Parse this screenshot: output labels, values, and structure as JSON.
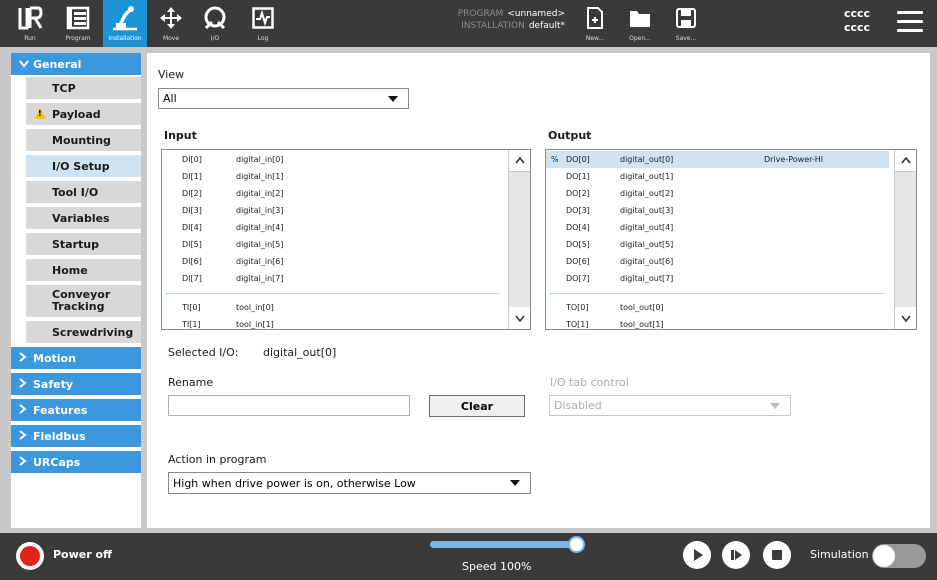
{
  "topbar": {
    "tabs": [
      {
        "label": "Run",
        "icon": "ur-logo-icon"
      },
      {
        "label": "Program",
        "icon": "program-icon"
      },
      {
        "label": "Installation",
        "icon": "installation-icon"
      },
      {
        "label": "Move",
        "icon": "move-icon"
      },
      {
        "label": "I/O",
        "icon": "io-icon"
      },
      {
        "label": "Log",
        "icon": "log-icon"
      }
    ],
    "program_key": "PROGRAM",
    "program_value": "<unnamed>",
    "installation_key": "INSTALLATION",
    "installation_value": "default*",
    "file_buttons": [
      {
        "label": "New...",
        "icon": "new-file-icon"
      },
      {
        "label": "Open...",
        "icon": "folder-icon"
      },
      {
        "label": "Save...",
        "icon": "save-icon"
      }
    ],
    "user_line1": "cccc",
    "user_line2": "cccc",
    "accent_color": "#1b94d6"
  },
  "sidebar": {
    "sections": [
      {
        "label": "General",
        "expanded": true
      },
      {
        "label": "Motion"
      },
      {
        "label": "Safety"
      },
      {
        "label": "Features"
      },
      {
        "label": "Fieldbus"
      },
      {
        "label": "URCaps"
      }
    ],
    "general_items": [
      {
        "label": "TCP"
      },
      {
        "label": "Payload",
        "warning": true
      },
      {
        "label": "Mounting"
      },
      {
        "label": "I/O Setup",
        "selected": true
      },
      {
        "label": "Tool I/O"
      },
      {
        "label": "Variables"
      },
      {
        "label": "Startup"
      },
      {
        "label": "Home"
      },
      {
        "label": "Conveyor Tracking"
      },
      {
        "label": "Screwdriving"
      }
    ]
  },
  "main": {
    "view_label": "View",
    "view_value": "All",
    "input_label": "Input",
    "output_label": "Output",
    "input_rows": [
      {
        "id": "DI[0]",
        "name": "digital_in[0]"
      },
      {
        "id": "DI[1]",
        "name": "digital_in[1]"
      },
      {
        "id": "DI[2]",
        "name": "digital_in[2]"
      },
      {
        "id": "DI[3]",
        "name": "digital_in[3]"
      },
      {
        "id": "DI[4]",
        "name": "digital_in[4]"
      },
      {
        "id": "DI[5]",
        "name": "digital_in[5]"
      },
      {
        "id": "DI[6]",
        "name": "digital_in[6]"
      },
      {
        "id": "DI[7]",
        "name": "digital_in[7]"
      },
      {
        "id": "TI[0]",
        "name": "tool_in[0]"
      },
      {
        "id": "TI[1]",
        "name": "tool_in[1]"
      }
    ],
    "output_rows": [
      {
        "prefix": "%",
        "id": "DO[0]",
        "name": "digital_out[0]",
        "action": "Drive-Power-HI"
      },
      {
        "id": "DO[1]",
        "name": "digital_out[1]"
      },
      {
        "id": "DO[2]",
        "name": "digital_out[2]"
      },
      {
        "id": "DO[3]",
        "name": "digital_out[3]"
      },
      {
        "id": "DO[4]",
        "name": "digital_out[4]"
      },
      {
        "id": "DO[5]",
        "name": "digital_out[5]"
      },
      {
        "id": "DO[6]",
        "name": "digital_out[6]"
      },
      {
        "id": "DO[7]",
        "name": "digital_out[7]"
      },
      {
        "id": "TO[0]",
        "name": "tool_out[0]"
      },
      {
        "id": "TO[1]",
        "name": "tool_out[1]"
      }
    ],
    "selected_io_label": "Selected I/O:",
    "selected_io_value": "digital_out[0]",
    "rename_label": "Rename",
    "rename_value": "",
    "clear_label": "Clear",
    "tab_control_label": "I/O tab control",
    "tab_control_value": "Disabled",
    "action_label": "Action in program",
    "action_value": "High when drive power is on, otherwise Low",
    "highlight_color": "#cfe3f3"
  },
  "bottombar": {
    "power_label": "Power off",
    "speed_label": "Speed 100%",
    "speed_fraction": 1.0,
    "simulation_label": "Simulation",
    "simulation_on": false
  }
}
